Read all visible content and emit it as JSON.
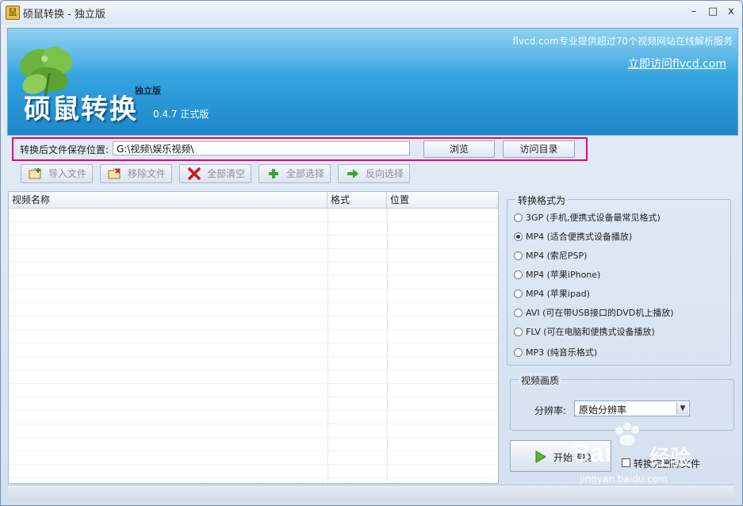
{
  "window": {
    "title": "硕鼠转换 - 独立版",
    "app_icon": "mouse-app-icon",
    "controls": {
      "minimize": "–",
      "maximize": "□",
      "close": "x"
    }
  },
  "banner": {
    "logo_title": "硕鼠转换",
    "edition": "独立版",
    "version": "0.4.7 正式版",
    "slogan": "flvcd.com专业提供超过70个视频网站在线解析服务",
    "link": "立即访问flvcd.com",
    "logo_icon": "clover-leaf-icon"
  },
  "path": {
    "label": "转换后文件保存位置:",
    "value": "G:\\视频\\娱乐视频\\",
    "browse_label": "浏览",
    "open_dir_label": "访问目录"
  },
  "toolbar": {
    "import_label": "导入文件",
    "remove_label": "移除文件",
    "clear_all_label": "全部清空",
    "select_all_label": "全部选择",
    "invert_label": "反向选择"
  },
  "list": {
    "columns": [
      "视频名称",
      "格式",
      "位置"
    ]
  },
  "format_group": {
    "title": "转换格式为",
    "options": [
      "3GP (手机,便携式设备最常见格式)",
      "MP4 (适合便携式设备播放)",
      "MP4 (索尼PSP)",
      "MP4 (苹果iPhone)",
      "MP4 (苹果ipad)",
      "AVI  (可在带USB接口的DVD机上播放)",
      "FLV  (可在电脑和便携式设备播放)",
      "MP3 (纯音乐格式)"
    ],
    "selected_index": 1
  },
  "quality_group": {
    "title": "视频画质",
    "resolution_label": "分辨率:",
    "resolution_value": "原始分辨率"
  },
  "actions": {
    "start_label": "开始转换",
    "delete_after_label": "转换完删除文件"
  },
  "watermark": {
    "brand": "Bai",
    "brand_cn": "经验",
    "url": "jingyan.baidu.com"
  },
  "colors": {
    "banner": "#2f9fdd",
    "highlight_box": "#e5007e",
    "window_bg": "#d4e0ef"
  }
}
